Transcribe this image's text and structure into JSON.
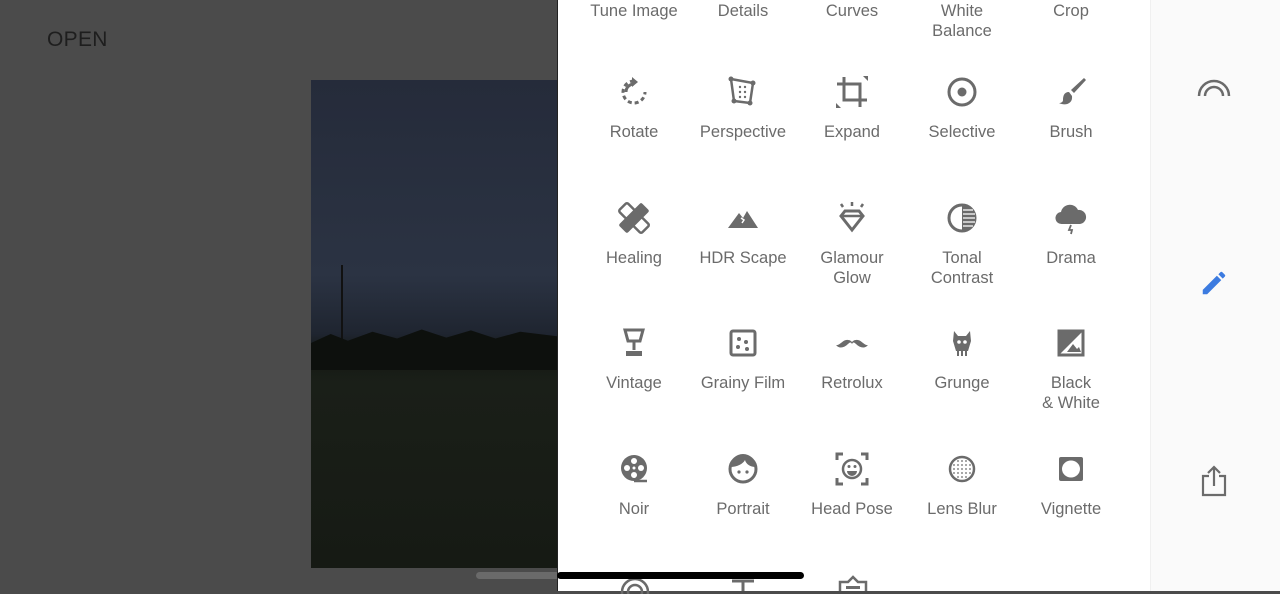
{
  "left": {
    "open_label": "OPEN"
  },
  "tools_top_row": [
    "Tune Image",
    "Details",
    "Curves",
    "White\nBalance",
    "Crop"
  ],
  "tools": [
    {
      "label": "Rotate",
      "icon": "rotate-icon"
    },
    {
      "label": "Perspective",
      "icon": "perspective-icon"
    },
    {
      "label": "Expand",
      "icon": "expand-icon"
    },
    {
      "label": "Selective",
      "icon": "selective-icon"
    },
    {
      "label": "Brush",
      "icon": "brush-icon"
    },
    {
      "label": "Healing",
      "icon": "healing-icon"
    },
    {
      "label": "HDR Scape",
      "icon": "mountain-icon"
    },
    {
      "label": "Glamour\nGlow",
      "icon": "diamond-icon"
    },
    {
      "label": "Tonal\nContrast",
      "icon": "tonal-contrast-icon"
    },
    {
      "label": "Drama",
      "icon": "storm-cloud-icon"
    },
    {
      "label": "Vintage",
      "icon": "lamp-icon"
    },
    {
      "label": "Grainy Film",
      "icon": "grain-icon"
    },
    {
      "label": "Retrolux",
      "icon": "mustache-icon"
    },
    {
      "label": "Grunge",
      "icon": "grunge-icon"
    },
    {
      "label": "Black\n& White",
      "icon": "black-white-icon"
    },
    {
      "label": "Noir",
      "icon": "film-reel-icon"
    },
    {
      "label": "Portrait",
      "icon": "face-icon"
    },
    {
      "label": "Head Pose",
      "icon": "head-pose-icon"
    },
    {
      "label": "Lens Blur",
      "icon": "lens-blur-icon"
    },
    {
      "label": "Vignette",
      "icon": "vignette-icon"
    }
  ],
  "rail": {
    "accent": "#3c7be0",
    "icon_color": "#6b6b6b"
  }
}
